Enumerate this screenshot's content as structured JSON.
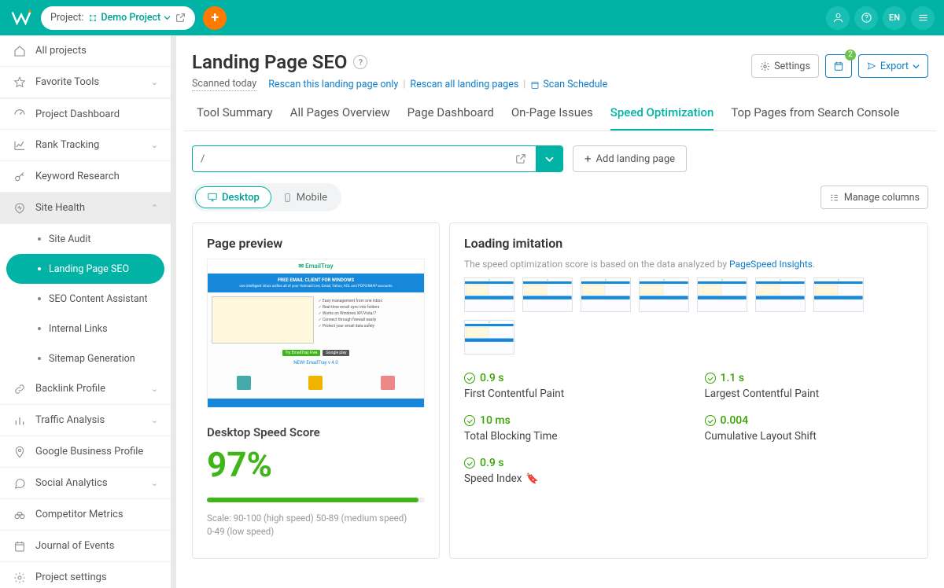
{
  "header": {
    "project_label": "Project:",
    "project_name": "Demo Project",
    "lang": "EN",
    "badge": "2"
  },
  "sidebar": {
    "all_projects": "All projects",
    "favorite": "Favorite Tools",
    "dashboard": "Project Dashboard",
    "rank": "Rank Tracking",
    "keyword": "Keyword Research",
    "sitehealth": "Site Health",
    "sh_audit": "Site Audit",
    "sh_landing": "Landing Page SEO",
    "sh_content": "SEO Content Assistant",
    "sh_links": "Internal Links",
    "sh_sitemap": "Sitemap Generation",
    "backlink": "Backlink Profile",
    "traffic": "Traffic Analysis",
    "gbp": "Google Business Profile",
    "social": "Social Analytics",
    "competitor": "Competitor Metrics",
    "journal": "Journal of Events",
    "settings": "Project settings"
  },
  "page": {
    "title": "Landing Page SEO",
    "scanned": "Scanned today",
    "rescan_one": "Rescan this landing page only",
    "rescan_all": "Rescan all landing pages",
    "scan_schedule": "Scan Schedule",
    "settings_btn": "Settings",
    "export_btn": "Export"
  },
  "tabs": {
    "t1": "Tool Summary",
    "t2": "All Pages Overview",
    "t3": "Page Dashboard",
    "t4": "On-Page Issues",
    "t5": "Speed Optimization",
    "t6": "Top Pages from Search Console"
  },
  "url": {
    "value": "/",
    "add_btn": "Add landing page"
  },
  "device": {
    "desktop": "Desktop",
    "mobile": "Mobile",
    "manage": "Manage columns"
  },
  "preview": {
    "title": "Page preview",
    "score_title": "Desktop Speed Score",
    "score_value": "97%",
    "score_pct": 97,
    "scale1": "Scale: 90-100 (high speed) 50-89 (medium speed)",
    "scale2": "0-49 (low speed)"
  },
  "loading": {
    "title": "Loading imitation",
    "note_pre": "The speed optimization score is based on the data analyzed by ",
    "note_link": "PageSpeed Insights",
    "metrics": {
      "fcp_v": "0.9 s",
      "fcp_l": "First Contentful Paint",
      "lcp_v": "1.1 s",
      "lcp_l": "Largest Contentful Paint",
      "tbt_v": "10 ms",
      "tbt_l": "Total Blocking Time",
      "cls_v": "0.004",
      "cls_l": "Cumulative Layout Shift",
      "si_v": "0.9 s",
      "si_l": "Speed Index"
    }
  }
}
